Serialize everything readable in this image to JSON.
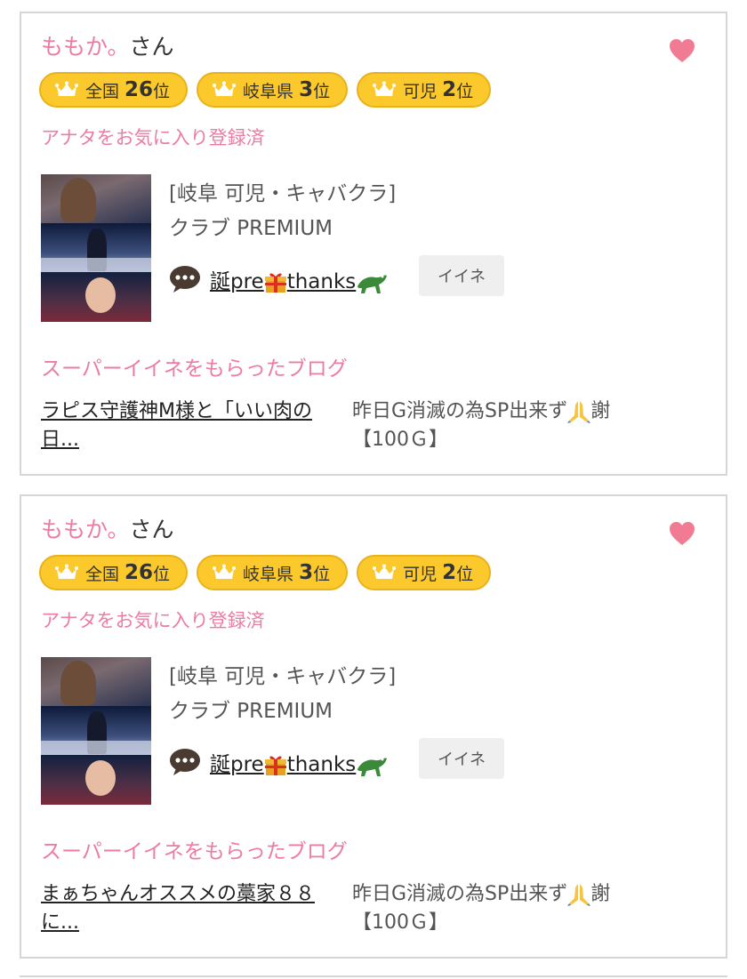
{
  "cards": [
    {
      "name": "ももか。",
      "honorific": "さん",
      "badges": [
        {
          "region": "全国",
          "rank": "26",
          "unit": "位"
        },
        {
          "region": "岐阜県",
          "rank": "3",
          "unit": "位"
        },
        {
          "region": "可児",
          "rank": "2",
          "unit": "位"
        }
      ],
      "favorite_text": "アナタをお気に入り登録済",
      "shop_category": "[岐阜 可児・キャバクラ]",
      "shop_name": "クラブ PREMIUM",
      "post_title_a": "誕pre",
      "post_title_b": "thanks",
      "iine_label": "イイネ",
      "section_title": "スーパーイイネをもらったブログ",
      "blog_title": "ラピス守護神M様と「いい肉の日...",
      "blog_meta_line1": "昨日G消滅の為SP出来ず",
      "blog_meta_line1b": "謝",
      "blog_meta_line2": "【100Ｇ】"
    },
    {
      "name": "ももか。",
      "honorific": "さん",
      "badges": [
        {
          "region": "全国",
          "rank": "26",
          "unit": "位"
        },
        {
          "region": "岐阜県",
          "rank": "3",
          "unit": "位"
        },
        {
          "region": "可児",
          "rank": "2",
          "unit": "位"
        }
      ],
      "favorite_text": "アナタをお気に入り登録済",
      "shop_category": "[岐阜 可児・キャバクラ]",
      "shop_name": "クラブ PREMIUM",
      "post_title_a": "誕pre",
      "post_title_b": "thanks",
      "iine_label": "イイネ",
      "section_title": "スーパーイイネをもらったブログ",
      "blog_title": "まぁちゃんオススメの藁家８８に...",
      "blog_meta_line1": "昨日G消滅の為SP出来ず",
      "blog_meta_line1b": "謝",
      "blog_meta_line2": "【100Ｇ】"
    }
  ],
  "icons": {
    "heart": "heart-icon",
    "crown": "crown-icon",
    "bubble": "speech-bubble-icon",
    "gift": "gift-icon",
    "crocodile": "crocodile-icon",
    "pray": "praying-hands-icon"
  },
  "colors": {
    "accent_pink": "#ec7ca3",
    "badge_yellow": "#fcc92d",
    "heart": "#f27b94"
  }
}
